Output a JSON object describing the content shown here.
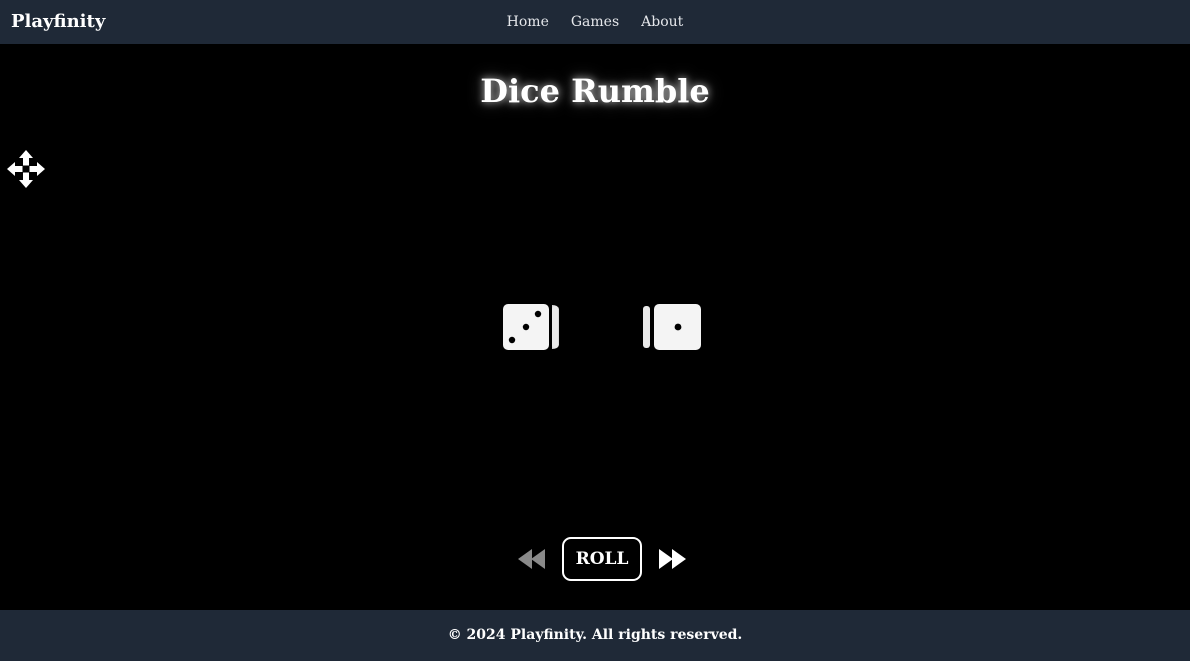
{
  "header": {
    "brand": "Playfinity",
    "nav": [
      "Home",
      "Games",
      "About"
    ]
  },
  "game": {
    "title": "Dice Rumble",
    "dice": [
      3,
      1
    ],
    "controls": {
      "prev_icon": "rewind-icon",
      "roll_label": "ROLL",
      "next_icon": "fast-forward-icon"
    },
    "move_icon": "move-icon"
  },
  "footer": {
    "text": "© 2024 Playfinity. All rights reserved."
  },
  "colors": {
    "bar": "#1f2937",
    "background": "#000000",
    "text": "#ffffff",
    "prev_icon": "#8a8a8a"
  }
}
